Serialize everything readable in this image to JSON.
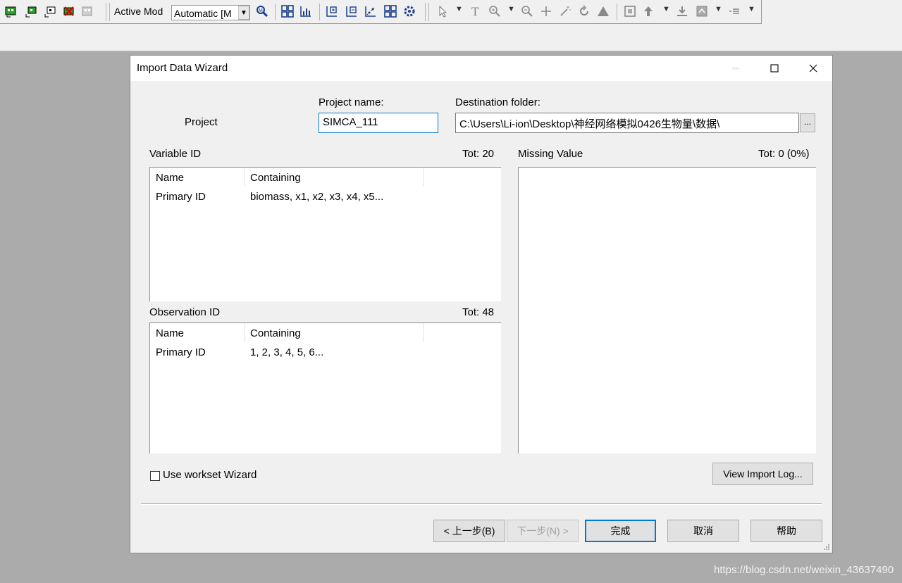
{
  "toolbar": {
    "active_mode_label": "Active Mod",
    "model_combo_value": "Automatic [M",
    "icons_left": [
      "plot-green-icon",
      "plot-green-small-icon",
      "plot-outline-icon",
      "plot-red-x-icon",
      "plot-gray-icon"
    ],
    "icons_mid": [
      "zoom-plot-icon",
      "grid-plot-icon",
      "scatter-plot-icon",
      "grid-add-icon",
      "grid-remove-icon",
      "scatter-diagonal-icon",
      "grid-refresh-icon",
      "grid-gear-icon"
    ],
    "icons_right": [
      "select-cursor-icon",
      "text-icon",
      "zoom-in-icon",
      "zoom-out-icon",
      "crosshair-icon",
      "magic-wand-icon",
      "rotate-icon",
      "triangle-icon",
      "plot-frame-icon",
      "highlight-icon",
      "download-icon",
      "plot-marker-icon",
      "list-icon"
    ]
  },
  "dialog": {
    "title": "Import Data Wizard",
    "project_label": "Project",
    "project_name_label": "Project name:",
    "project_name_value": "SIMCA_111",
    "destination_label": "Destination folder:",
    "destination_value": "C:\\Users\\Li-ion\\Desktop\\神经网络模拟0426生物量\\数据\\",
    "browse_label": "...",
    "variable_id": {
      "title": "Variable ID",
      "total": "Tot: 20",
      "columns": [
        "Name",
        "Containing"
      ],
      "rows": [
        [
          "Primary ID",
          "biomass, x1, x2, x3, x4, x5..."
        ]
      ]
    },
    "observation_id": {
      "title": "Observation ID",
      "total": "Tot: 48",
      "columns": [
        "Name",
        "Containing"
      ],
      "rows": [
        [
          "Primary ID",
          "1, 2, 3, 4, 5, 6..."
        ]
      ]
    },
    "missing_value": {
      "title": "Missing Value",
      "total": "Tot: 0 (0%)"
    },
    "workset_checkbox_label": "Use workset Wizard",
    "workset_checked": false,
    "view_log_label": "View Import Log...",
    "buttons": {
      "back": "< 上一步(B)",
      "next": "下一步(N) >",
      "finish": "完成",
      "cancel": "取消",
      "help": "帮助"
    }
  },
  "watermark": "https://blog.csdn.net/weixin_43637490",
  "colors": {
    "accent": "#0078d7",
    "workspace": "#ababab",
    "dialog_bg": "#f0f0f0"
  }
}
